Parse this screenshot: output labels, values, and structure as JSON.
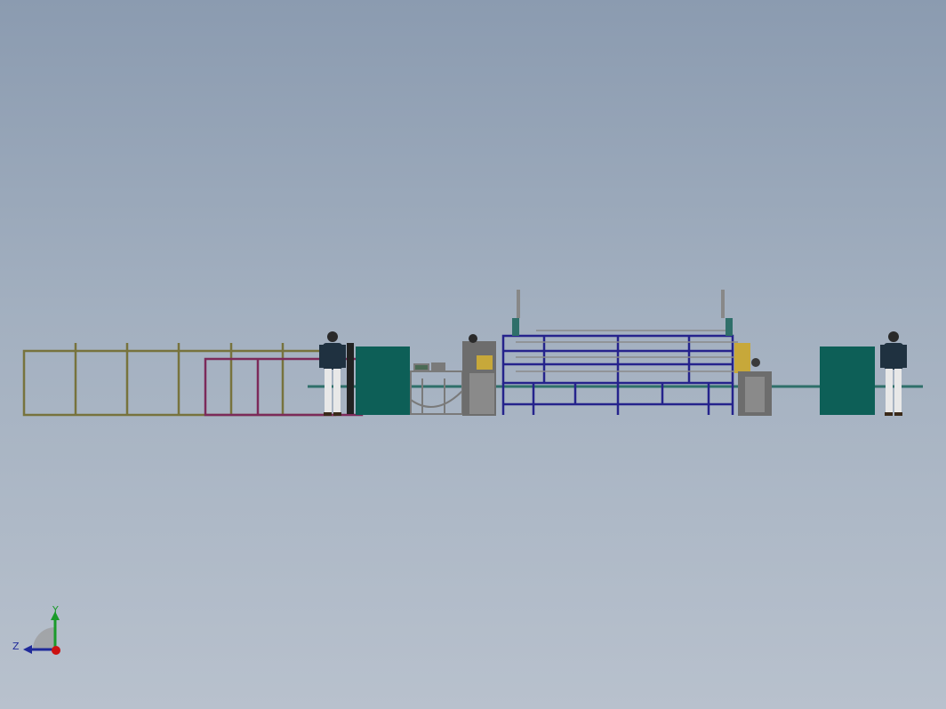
{
  "viewport": {
    "background_top": "#8b9bb0",
    "background_bottom": "#b8c1cd"
  },
  "colors": {
    "olive_frame": "#77733d",
    "magenta_frame": "#7c2a5a",
    "teal_cabinet": "#0d5f57",
    "navy_frame": "#25238c",
    "grey_steel": "#7a7a7a",
    "rail": "#2f6f6a"
  },
  "triad": {
    "y_label": "Y",
    "z_label": "Z",
    "y_color": "#1a9a2a",
    "z_color": "#1f2a9a",
    "origin_color": "#cc1111"
  }
}
